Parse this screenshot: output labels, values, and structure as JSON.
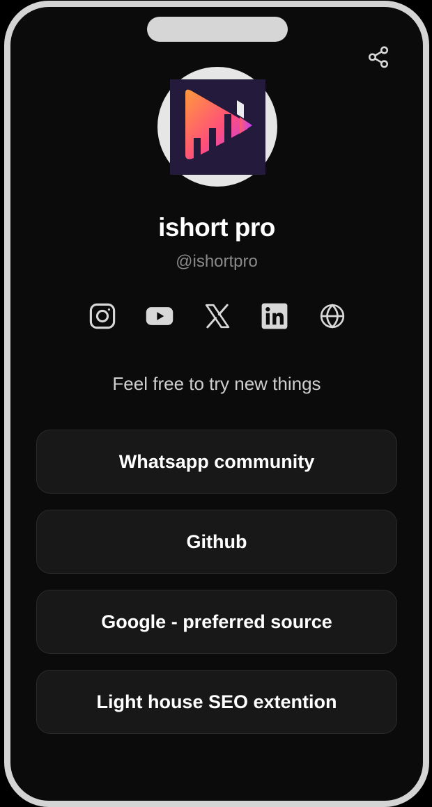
{
  "profile": {
    "name": "ishort pro",
    "handle": "@ishortpro",
    "bio": "Feel free to try new things"
  },
  "socials": [
    {
      "icon": "instagram-icon"
    },
    {
      "icon": "youtube-icon"
    },
    {
      "icon": "x-icon"
    },
    {
      "icon": "linkedin-icon"
    },
    {
      "icon": "globe-icon"
    }
  ],
  "links": [
    {
      "label": "Whatsapp community"
    },
    {
      "label": "Github"
    },
    {
      "label": "Google - preferred source"
    },
    {
      "label": "Light house SEO extention"
    }
  ],
  "colors": {
    "background": "#0b0b0c",
    "frame": "#d4d4d4",
    "button_bg": "#181818",
    "text_primary": "#ffffff",
    "text_secondary": "#8a8a8a",
    "logo_gradient": [
      "#ff9a3c",
      "#ff4f7a",
      "#b93dff"
    ]
  }
}
